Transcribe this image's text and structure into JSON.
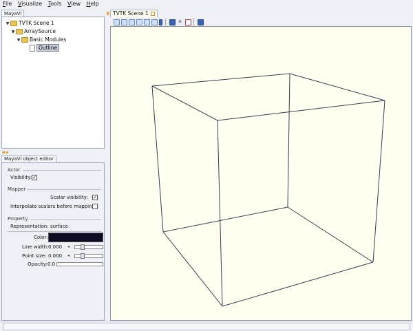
{
  "menu": [
    "File",
    "Visualize",
    "Tools",
    "View",
    "Help"
  ],
  "menu_underline": [
    "F",
    "V",
    "T",
    "V",
    "H"
  ],
  "left_dock": {
    "tab_label": "MayaVi",
    "tree": [
      {
        "label": "TVTK Scene 1",
        "icon": "folder-icon",
        "expanded": true
      },
      {
        "label": "ArraySource",
        "icon": "folder-icon",
        "expanded": true
      },
      {
        "label": "Basic Modules",
        "icon": "folder-icon",
        "expanded": true
      },
      {
        "label": "Outline",
        "icon": "file-icon",
        "selected": true
      }
    ]
  },
  "editor": {
    "tab_label": "MayaVi object editor",
    "actor": {
      "title": "Actor",
      "visibility_label": "Visibility:",
      "visibility": true
    },
    "mapper": {
      "title": "Mapper",
      "scalar_visibility_label": "Scalar visibility:",
      "scalar_visibility": true,
      "interpolate_label": "Interpolate scalars before mapping:",
      "interpolate": false
    },
    "property": {
      "title": "Property",
      "representation_label": "Representation:",
      "representation": "surface",
      "color_label": "Color:",
      "color": "#0c0c24",
      "line_width_label": "Line width:",
      "line_width": "0.000",
      "point_size_label": "Point size:",
      "point_size": "0.000",
      "opacity_label": "Opacity:",
      "opacity": "0.0"
    }
  },
  "scene": {
    "tab_label": "TVTK Scene 1",
    "toolbar_icons": [
      "view-x-positive-icon",
      "view-x-negative-icon",
      "view-y-positive-icon",
      "view-y-negative-icon",
      "view-z-positive-icon",
      "view-z-negative-icon",
      "isometric-view-icon",
      "parallel-projection-icon",
      "axes-icon",
      "full-screen-icon",
      "save-icon"
    ],
    "background_color": "#fffff0",
    "outline_color": "#3a3a52"
  },
  "status": ""
}
